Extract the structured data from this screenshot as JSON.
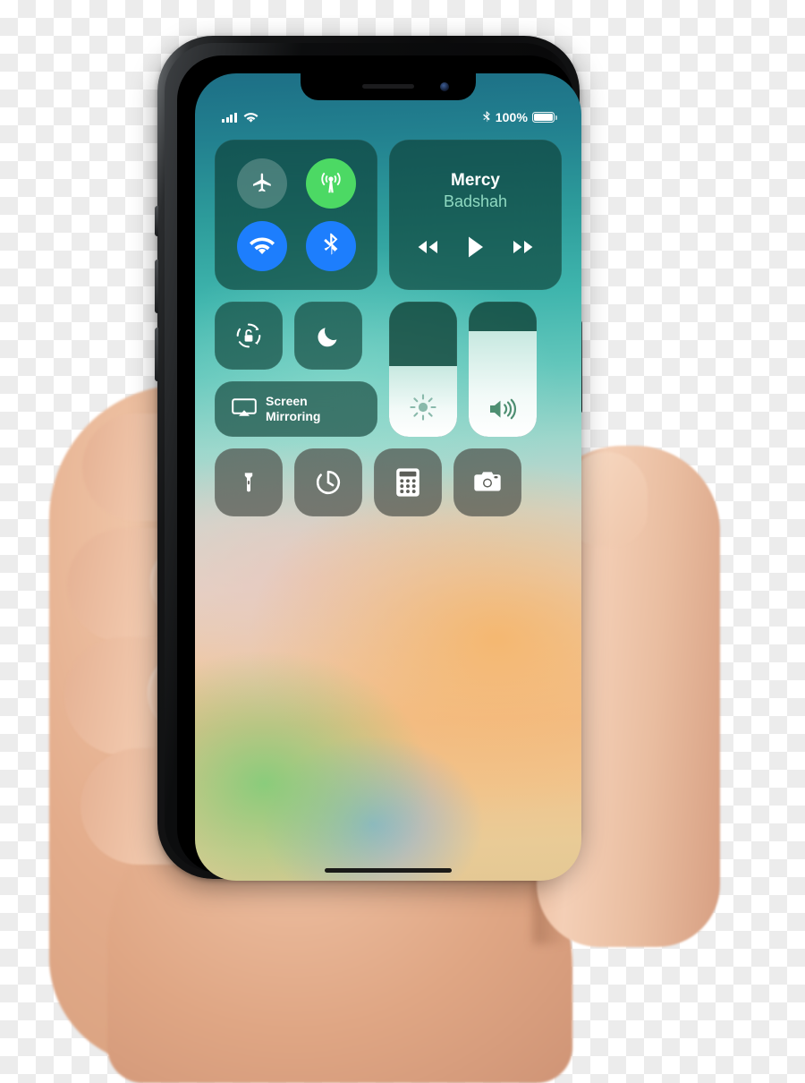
{
  "device": {
    "name": "iPhone X",
    "frame_color": "#0b0b0c",
    "held_in_hand": true
  },
  "status_bar": {
    "cellular_icon": "cellular-bars-icon",
    "cellular_bars": 4,
    "wifi_icon": "wifi-icon",
    "bluetooth_icon": "bluetooth-icon",
    "battery_percent": "100%",
    "battery_icon": "battery-full-icon",
    "battery_level": 100,
    "text_color": "#ffffff"
  },
  "control_center": {
    "connectivity": {
      "name": "connectivity-module",
      "toggles": [
        {
          "name": "airplane-mode",
          "icon": "airplane-icon",
          "state": "off",
          "color": "#7d9c93"
        },
        {
          "name": "cellular-data",
          "icon": "cellular-tower-icon",
          "state": "on",
          "color": "#4cd964"
        },
        {
          "name": "wifi",
          "icon": "wifi-icon",
          "state": "on",
          "color": "#1d7efd"
        },
        {
          "name": "bluetooth",
          "icon": "bluetooth-icon",
          "state": "on",
          "color": "#1d7efd"
        }
      ]
    },
    "now_playing": {
      "name": "now-playing-module",
      "title": "Mercy",
      "artist": "Badshah",
      "title_color": "#ffffff",
      "artist_color": "#8fd9c1",
      "controls": [
        {
          "name": "rewind-button",
          "icon": "rewind-icon"
        },
        {
          "name": "play-button",
          "icon": "play-icon"
        },
        {
          "name": "forward-button",
          "icon": "fast-forward-icon"
        }
      ]
    },
    "rotation_lock": {
      "name": "rotation-lock-toggle",
      "icon": "rotation-lock-icon",
      "state": "off"
    },
    "do_not_disturb": {
      "name": "do-not-disturb-toggle",
      "icon": "moon-icon",
      "state": "off"
    },
    "screen_mirroring": {
      "name": "screen-mirroring-tile",
      "icon": "airplay-icon",
      "label_line1": "Screen",
      "label_line2": "Mirroring"
    },
    "brightness_slider": {
      "name": "brightness-slider",
      "icon": "brightness-icon",
      "value_percent": 52,
      "fill_color": "#ffffff"
    },
    "volume_slider": {
      "name": "volume-slider",
      "icon": "volume-icon",
      "value_percent": 78,
      "fill_color": "#ffffff"
    },
    "utilities": [
      {
        "name": "flashlight-button",
        "icon": "flashlight-icon"
      },
      {
        "name": "timer-button",
        "icon": "timer-icon"
      },
      {
        "name": "calculator-button",
        "icon": "calculator-icon"
      },
      {
        "name": "camera-button",
        "icon": "camera-icon"
      }
    ]
  },
  "wallpaper": {
    "name": "blurred-wallpaper",
    "top_color": "#1d6f86",
    "mid_color": "#62c6bb",
    "bottom_color": "#f2bf8e"
  },
  "home_indicator": {
    "name": "home-indicator",
    "color": "#0c0c0c"
  },
  "background": {
    "type": "transparency-checkerboard",
    "light": "#ffffff",
    "dark": "#ececec"
  }
}
